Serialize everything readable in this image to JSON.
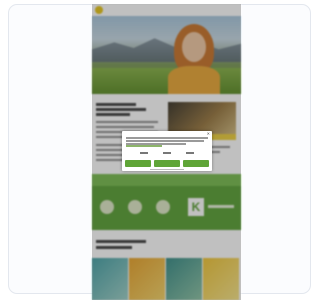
{
  "app": {
    "brand": "",
    "header_icons": ""
  },
  "dialog": {
    "title": "",
    "close_icon": "close-icon",
    "buttons": [
      "",
      "",
      ""
    ]
  },
  "colors": {
    "accent_green": "#5fa537",
    "accent_yellow": "#f0d23a",
    "promo_green": "#5ea23a"
  },
  "promo": {
    "k_letter": "K"
  }
}
